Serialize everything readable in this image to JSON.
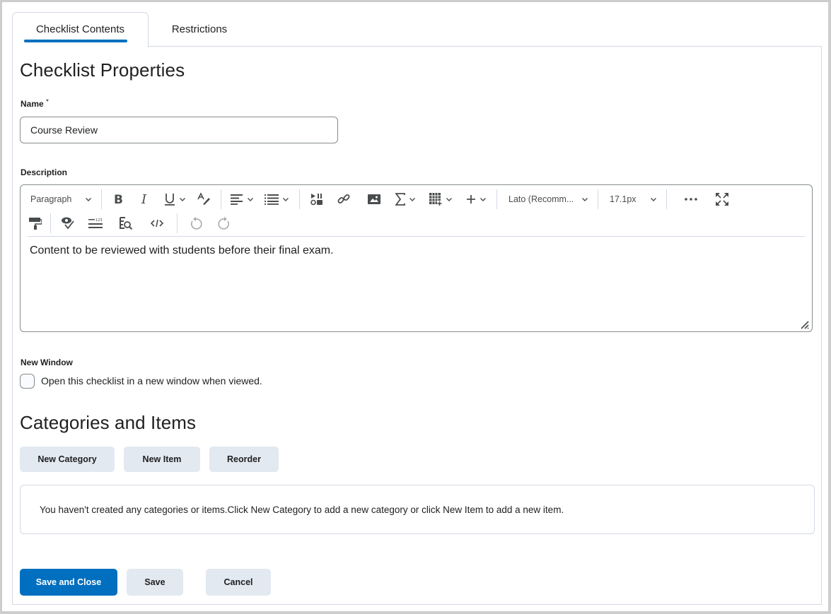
{
  "tabs": [
    {
      "label": "Checklist Contents",
      "active": true
    },
    {
      "label": "Restrictions",
      "active": false
    }
  ],
  "properties": {
    "heading": "Checklist Properties",
    "name_label": "Name",
    "required_marker": "*",
    "name_value": "Course Review",
    "description_label": "Description"
  },
  "editor": {
    "toolbar_row1": [
      {
        "icon": "paragraph-format",
        "label": "Paragraph",
        "dropdown": true
      },
      {
        "icon": "bold-icon"
      },
      {
        "icon": "italic-icon"
      },
      {
        "icon": "underline-icon",
        "dropdown": true
      },
      {
        "icon": "strikethrough-format-icon"
      },
      {
        "icon": "align-left-icon",
        "dropdown": true
      },
      {
        "icon": "bullet-list-icon",
        "dropdown": true
      },
      {
        "icon": "insert-stuff-icon"
      },
      {
        "icon": "link-icon"
      },
      {
        "icon": "image-icon"
      },
      {
        "icon": "equation-icon",
        "dropdown": true
      },
      {
        "icon": "table-icon",
        "dropdown": true
      },
      {
        "icon": "plus-icon",
        "dropdown": true
      },
      {
        "icon": "font-family",
        "label": "Lato (Recomm...",
        "dropdown": true
      },
      {
        "icon": "font-size",
        "label": "17.1px",
        "dropdown": true
      },
      {
        "icon": "more-icon"
      },
      {
        "icon": "fullscreen-icon"
      }
    ],
    "toolbar_row2": [
      {
        "icon": "format-painter-icon"
      },
      {
        "icon": "accessibility-checker-icon"
      },
      {
        "icon": "word-count-icon"
      },
      {
        "icon": "preview-icon"
      },
      {
        "icon": "source-code-icon"
      },
      {
        "icon": "undo-icon"
      },
      {
        "icon": "redo-icon"
      }
    ],
    "paragraph_label": "Paragraph",
    "font_family": "Lato (Recomm...",
    "font_size": "17.1px",
    "content": "Content to be reviewed with students before their final exam."
  },
  "new_window": {
    "label": "New Window",
    "checkbox_label": "Open this checklist in a new window when viewed.",
    "checked": false
  },
  "categories": {
    "heading": "Categories and Items",
    "buttons": {
      "new_category": "New Category",
      "new_item": "New Item",
      "reorder": "Reorder"
    },
    "empty_message": "You haven't created any categories or items.Click New Category to add a new category or click New Item to add a new item."
  },
  "footer": {
    "save_and_close": "Save and Close",
    "save": "Save",
    "cancel": "Cancel"
  },
  "colors": {
    "primary": "#006fbf",
    "secondary_button": "#e3e9f1",
    "border": "#d3d9e3"
  }
}
